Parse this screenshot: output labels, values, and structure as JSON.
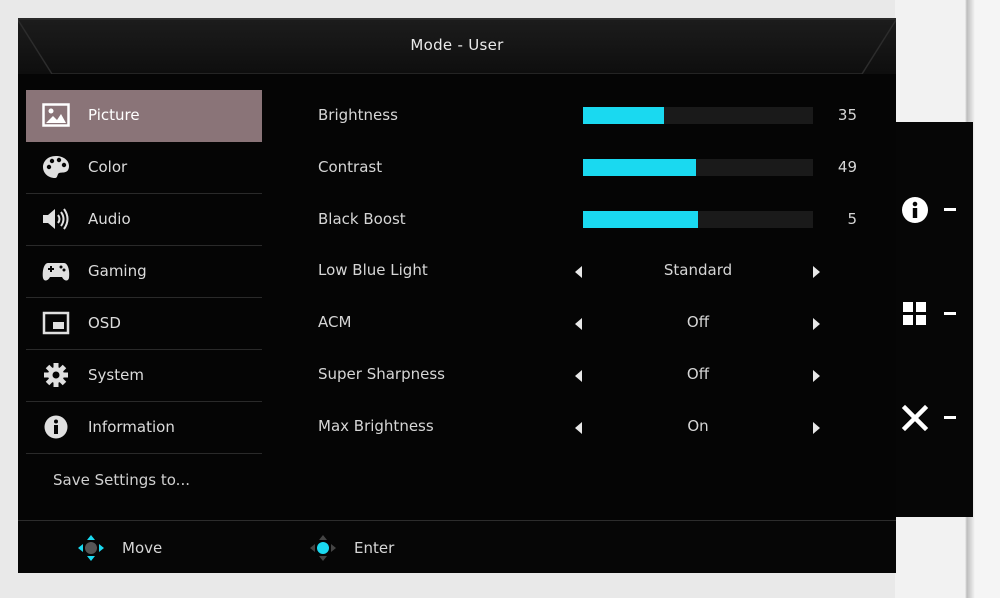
{
  "title": "Mode - User",
  "sidebar": {
    "items": [
      {
        "label": "Picture",
        "icon": "picture-icon",
        "selected": true
      },
      {
        "label": "Color",
        "icon": "palette-icon",
        "selected": false
      },
      {
        "label": "Audio",
        "icon": "speaker-icon",
        "selected": false
      },
      {
        "label": "Gaming",
        "icon": "gamepad-icon",
        "selected": false
      },
      {
        "label": "OSD",
        "icon": "osd-window-icon",
        "selected": false
      },
      {
        "label": "System",
        "icon": "gear-icon",
        "selected": false
      },
      {
        "label": "Information",
        "icon": "info-icon",
        "selected": false
      }
    ],
    "save_label": "Save Settings to..."
  },
  "settings": {
    "brightness": {
      "label": "Brightness",
      "value": "35",
      "fill_fraction": 0.35
    },
    "contrast": {
      "label": "Contrast",
      "value": "49",
      "fill_fraction": 0.49
    },
    "black_boost": {
      "label": "Black Boost",
      "value": "5",
      "fill_fraction": 0.5
    },
    "low_blue_light": {
      "label": "Low Blue Light",
      "value": "Standard"
    },
    "acm": {
      "label": "ACM",
      "value": "Off"
    },
    "super_sharpness": {
      "label": "Super Sharpness",
      "value": "Off"
    },
    "max_brightness": {
      "label": "Max Brightness",
      "value": "On"
    }
  },
  "footer": {
    "move_label": "Move",
    "enter_label": "Enter"
  },
  "side_buttons": [
    {
      "icon": "info-icon"
    },
    {
      "icon": "grid-icon"
    },
    {
      "icon": "close-icon"
    }
  ],
  "colors": {
    "accent": "#1ad9f0",
    "selected_bg": "#8a7478",
    "background": "#050505"
  }
}
